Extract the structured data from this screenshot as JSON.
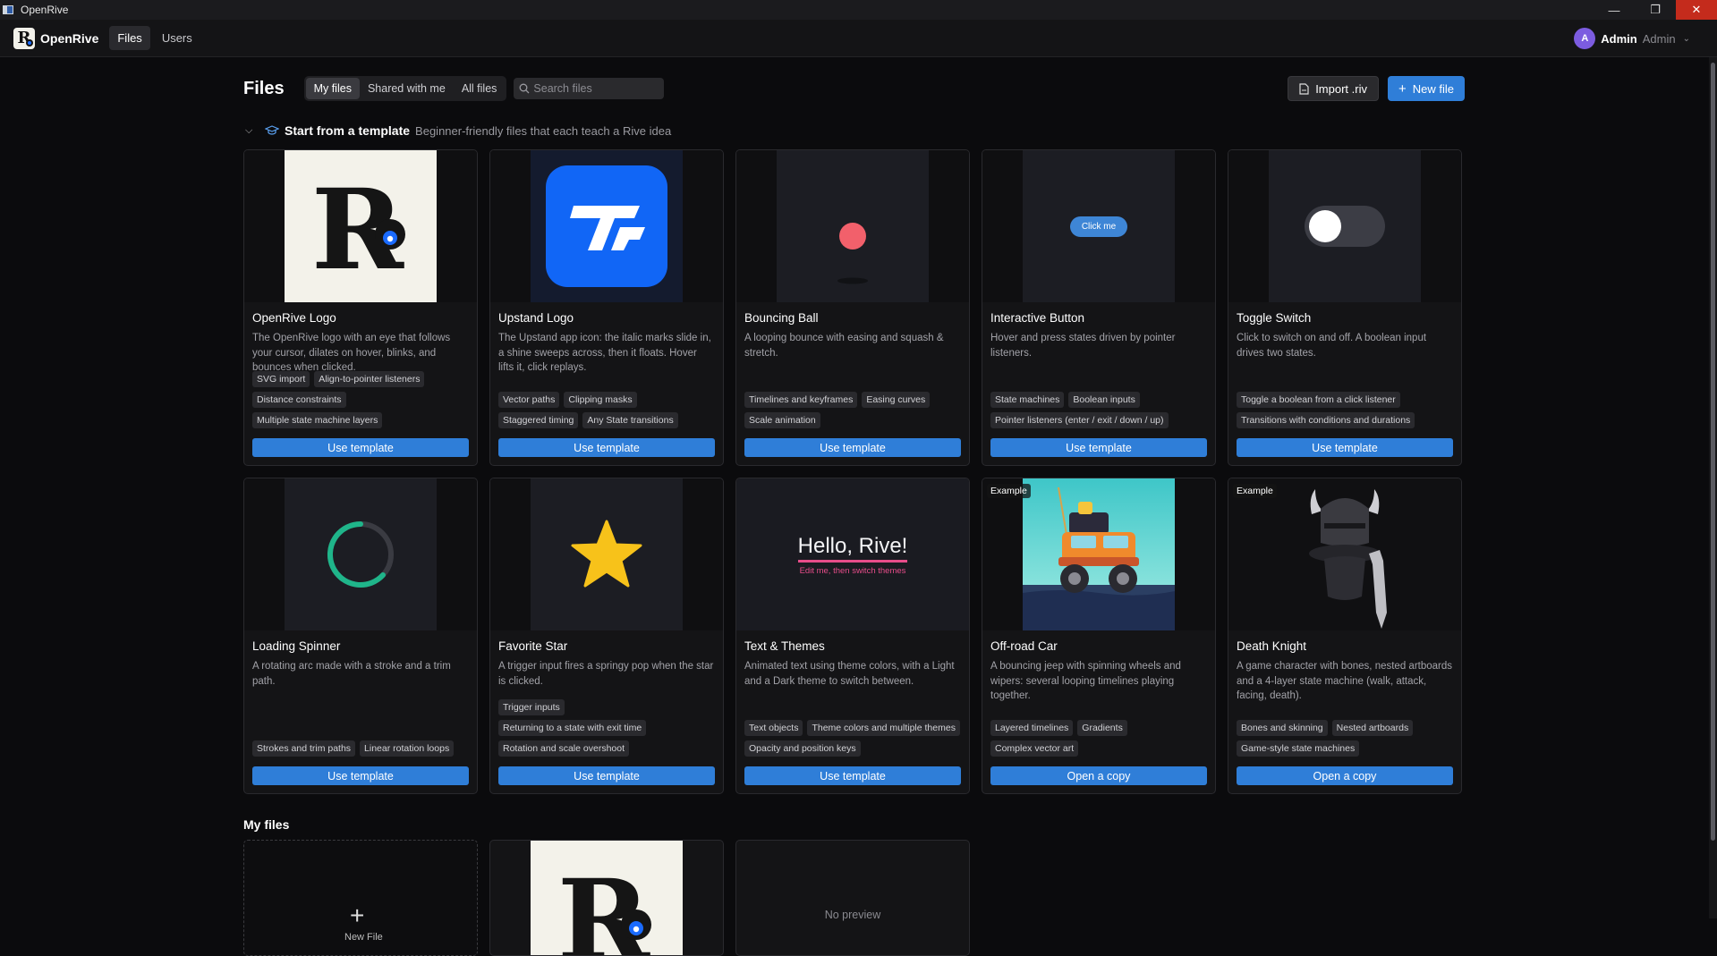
{
  "window": {
    "title": "OpenRive"
  },
  "nav": {
    "brand": "OpenRive",
    "tabs": [
      {
        "label": "Files"
      },
      {
        "label": "Users"
      }
    ],
    "user": {
      "initial": "A",
      "name": "Admin",
      "role": "Admin"
    }
  },
  "toolbar": {
    "title": "Files",
    "filters": [
      {
        "label": "My files"
      },
      {
        "label": "Shared with me"
      },
      {
        "label": "All files"
      }
    ],
    "search_placeholder": "Search files",
    "import_label": "Import .riv",
    "new_label": "New file"
  },
  "templates_section": {
    "title": "Start from a template",
    "subtitle": "Beginner-friendly files that each teach a Rive idea"
  },
  "templates": [
    {
      "title": "OpenRive Logo",
      "desc": "The OpenRive logo with an eye that follows your cursor, dilates on hover, blinks, and bounces when clicked.",
      "tags": [
        "SVG import",
        "Align-to-pointer listeners",
        "Distance constraints",
        "Multiple state machine layers"
      ],
      "button": "Use template"
    },
    {
      "title": "Upstand Logo",
      "desc": "The Upstand app icon: the italic marks slide in, a shine sweeps across, then it floats. Hover lifts it, click replays.",
      "tags": [
        "Vector paths",
        "Clipping masks",
        "Staggered timing",
        "Any State transitions"
      ],
      "button": "Use template"
    },
    {
      "title": "Bouncing Ball",
      "desc": "A looping bounce with easing and squash & stretch.",
      "tags": [
        "Timelines and keyframes",
        "Easing curves",
        "Scale animation"
      ],
      "button": "Use template"
    },
    {
      "title": "Interactive Button",
      "desc": "Hover and press states driven by pointer listeners.",
      "tags": [
        "State machines",
        "Boolean inputs",
        "Pointer listeners (enter / exit / down / up)"
      ],
      "button": "Use template",
      "thumb_label": "Click me"
    },
    {
      "title": "Toggle Switch",
      "desc": "Click to switch on and off. A boolean input drives two states.",
      "tags": [
        "Toggle a boolean from a click listener",
        "Transitions with conditions and durations"
      ],
      "button": "Use template"
    },
    {
      "title": "Loading Spinner",
      "desc": "A rotating arc made with a stroke and a trim path.",
      "tags": [
        "Strokes and trim paths",
        "Linear rotation loops"
      ],
      "button": "Use template"
    },
    {
      "title": "Favorite Star",
      "desc": "A trigger input fires a springy pop when the star is clicked.",
      "tags": [
        "Trigger inputs",
        "Returning to a state with exit time",
        "Rotation and scale overshoot"
      ],
      "button": "Use template"
    },
    {
      "title": "Text & Themes",
      "desc": "Animated text using theme colors, with a Light and a Dark theme to switch between.",
      "tags": [
        "Text objects",
        "Theme colors and multiple themes",
        "Opacity and position keys"
      ],
      "button": "Use template",
      "thumb_text": "Hello, Rive!",
      "thumb_sub": "Edit me, then switch themes"
    },
    {
      "title": "Off-road Car",
      "desc": "A bouncing jeep with spinning wheels and wipers: several looping timelines playing together.",
      "tags": [
        "Layered timelines",
        "Gradients",
        "Complex vector art"
      ],
      "button": "Open a copy",
      "badge": "Example"
    },
    {
      "title": "Death Knight",
      "desc": "A game character with bones, nested artboards and a 4-layer state machine (walk, attack, facing, death).",
      "tags": [
        "Bones and skinning",
        "Nested artboards",
        "Game-style state machines"
      ],
      "button": "Open a copy",
      "badge": "Example"
    }
  ],
  "my_files": {
    "title": "My files",
    "new_file_label": "New File",
    "no_preview": "No preview"
  },
  "colors": {
    "accent": "#2f7ed8",
    "background": "#0b0b0d",
    "card": "#141416",
    "avatar": "#7c5ce0"
  }
}
